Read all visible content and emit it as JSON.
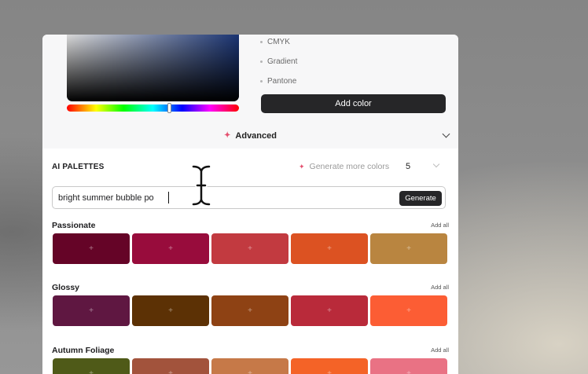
{
  "color_formats": [
    "CMYK",
    "Gradient",
    "Pantone"
  ],
  "add_color_label": "Add color",
  "advanced_label": "Advanced",
  "ai_palettes": {
    "title": "AI PALETTES",
    "generate_more_label": "Generate more colors",
    "count_value": "5",
    "prompt_value": "bright summer bubble po",
    "generate_label": "Generate"
  },
  "add_all_label": "Add all",
  "palettes": [
    {
      "name": "Passionate",
      "colors": [
        "#650427",
        "#980c3c",
        "#c23a40",
        "#dc5222",
        "#b98540"
      ]
    },
    {
      "name": "Glossy",
      "colors": [
        "#5f1741",
        "#5c3105",
        "#8e4214",
        "#b92a3a",
        "#fc5d34"
      ]
    },
    {
      "name": "Autumn Foliage",
      "colors": [
        "#4f5a18",
        "#a2533c",
        "#c67948",
        "#f46327",
        "#e97284"
      ]
    }
  ]
}
